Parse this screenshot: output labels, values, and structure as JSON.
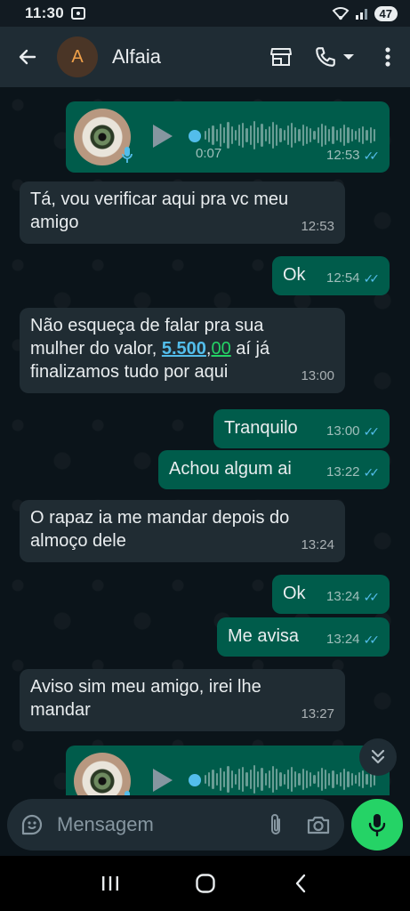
{
  "status_bar": {
    "time": "11:30",
    "battery": "47"
  },
  "header": {
    "avatar_initial": "A",
    "contact_name": "Alfaia"
  },
  "messages": [
    {
      "type": "voice",
      "direction": "out",
      "duration": "0:07",
      "time": "12:53",
      "read": true
    },
    {
      "type": "text",
      "direction": "in",
      "line1": "Tá, vou verificar aqui pra vc meu",
      "line2": "amigo",
      "time": "12:53"
    },
    {
      "type": "text",
      "direction": "out",
      "text": "Ok",
      "time": "12:54",
      "read": true
    },
    {
      "type": "text",
      "direction": "in",
      "line1": "Não esqueça de falar pra sua",
      "line2_prefix": "mulher do valor, ",
      "amount_main": "5.500",
      "amount_sep": ",",
      "amount_cents": "00",
      "line2_suffix": " aí já",
      "line3": "finalizamos tudo por aqui",
      "time": "13:00"
    },
    {
      "type": "text",
      "direction": "out",
      "text": "Tranquilo",
      "time": "13:00",
      "read": true
    },
    {
      "type": "text",
      "direction": "out",
      "text": "Achou algum ai",
      "time": "13:22",
      "read": true
    },
    {
      "type": "text",
      "direction": "in",
      "line1": "O rapaz ia me mandar depois do",
      "line2": "almoço dele",
      "time": "13:24"
    },
    {
      "type": "text",
      "direction": "out",
      "text": "Ok",
      "time": "13:24",
      "read": true
    },
    {
      "type": "text",
      "direction": "out",
      "text": "Me avisa",
      "time": "13:24",
      "read": true
    },
    {
      "type": "text",
      "direction": "in",
      "line1": "Aviso sim meu amigo, irei lhe",
      "line2": "mandar",
      "time": "13:27"
    },
    {
      "type": "voice",
      "direction": "out",
      "partial": true
    }
  ],
  "input": {
    "placeholder": "Mensagem"
  },
  "colors": {
    "outgoing": "#005c4b",
    "incoming": "#202c33",
    "accent": "#25d366",
    "read_ticks": "#53bdeb"
  },
  "icons": [
    "back-arrow-icon",
    "shop-icon",
    "phone-icon",
    "chevron-down-icon",
    "more-vert-icon",
    "sticker-icon",
    "attach-icon",
    "camera-icon",
    "mic-icon",
    "double-chevron-down-icon",
    "recents-icon",
    "home-icon",
    "back-nav-icon"
  ]
}
